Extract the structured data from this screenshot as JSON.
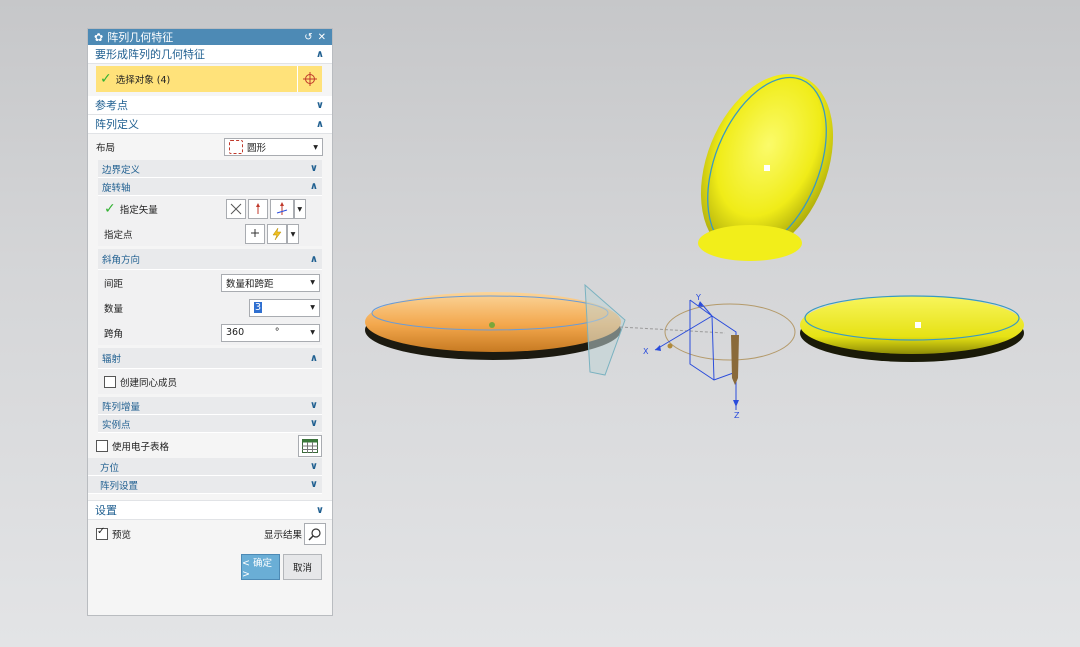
{
  "dialog": {
    "title": "阵列几何特征",
    "reset_icon": "↺",
    "close_icon": "✕",
    "sec_features": "要形成阵列的几何特征",
    "select_object": "选择对象 (4)",
    "sec_ref_point": "参考点",
    "sec_array_def": "阵列定义",
    "layout_label": "布局",
    "layout_value": "圆形",
    "sub_boundary": "边界定义",
    "sub_rotation_axis": "旋转轴",
    "specify_vector": "指定矢量",
    "specify_point": "指定点",
    "sub_angle_dir": "斜角方向",
    "spacing_label": "间距",
    "spacing_value": "数量和跨距",
    "count_label": "数量",
    "count_value": "3",
    "span_label": "跨角",
    "span_value": "360",
    "span_unit": "°",
    "sub_radiate": "辐射",
    "concentric_label": "创建同心成员",
    "sub_increment": "阵列增量",
    "sub_instance": "实例点",
    "spreadsheet_label": "使用电子表格",
    "sec_orientation": "方位",
    "sec_array_settings": "阵列设置",
    "sec_settings": "设置",
    "preview_label": "预览",
    "show_result_label": "显示结果",
    "ok_label": "< 确定 >",
    "cancel_label": "取消"
  },
  "viewport": {
    "axis_x": "X",
    "axis_y": "Y",
    "axis_z": "Z"
  },
  "colors": {
    "title_bar": "#4d8ab5",
    "section_text": "#1f5f90",
    "selected_row": "#ffe27a",
    "ok_button": "#6aaed6",
    "yellow_body": "#f4f025",
    "orange_body": "#f5a64a"
  }
}
